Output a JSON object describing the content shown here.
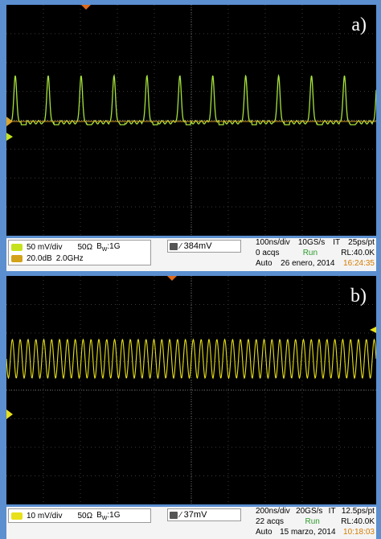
{
  "panels": [
    {
      "letter": "a)",
      "channel": {
        "scale": "50 mV/div",
        "impedance": "50Ω",
        "bandwidth": "B",
        "bandwidth_sub": "W",
        "bandwidth_val": ":1G",
        "color": "#c6e21e",
        "math_value": "20.0dB",
        "math_freq": "2.0GHz",
        "math_color": "#d3a21a"
      },
      "trigger": {
        "slope": "∕",
        "level": "384mV"
      },
      "horizontal": {
        "timebase": "100ns/div",
        "sample_rate": "10GS/s",
        "interp": "IT",
        "resolution": "25ps/pt",
        "acqs": "0 acqs",
        "state": "Run",
        "record_length": "RL:40.0K",
        "mode": "Auto",
        "date": "26 enero, 2014",
        "time": "16:24:35"
      },
      "trace": {
        "type": "pulses",
        "count": 11,
        "color": "#a6e23a"
      }
    },
    {
      "letter": "b)",
      "channel": {
        "scale": "10 mV/div",
        "impedance": "50Ω",
        "bandwidth": "B",
        "bandwidth_sub": "W",
        "bandwidth_val": ":1G",
        "color": "#e8e01a"
      },
      "trigger": {
        "slope": "∕",
        "level": "37mV"
      },
      "horizontal": {
        "timebase": "200ns/div",
        "sample_rate": "20GS/s",
        "interp": "IT",
        "resolution": "12.5ps/pt",
        "acqs": "22 acqs",
        "state": "Run",
        "record_length": "RL:40.0K",
        "mode": "Auto",
        "date": "15 marzo, 2014",
        "time": "10:18:03"
      },
      "trace": {
        "type": "sine",
        "cycles": 47,
        "color": "#e8e01a"
      }
    }
  ]
}
